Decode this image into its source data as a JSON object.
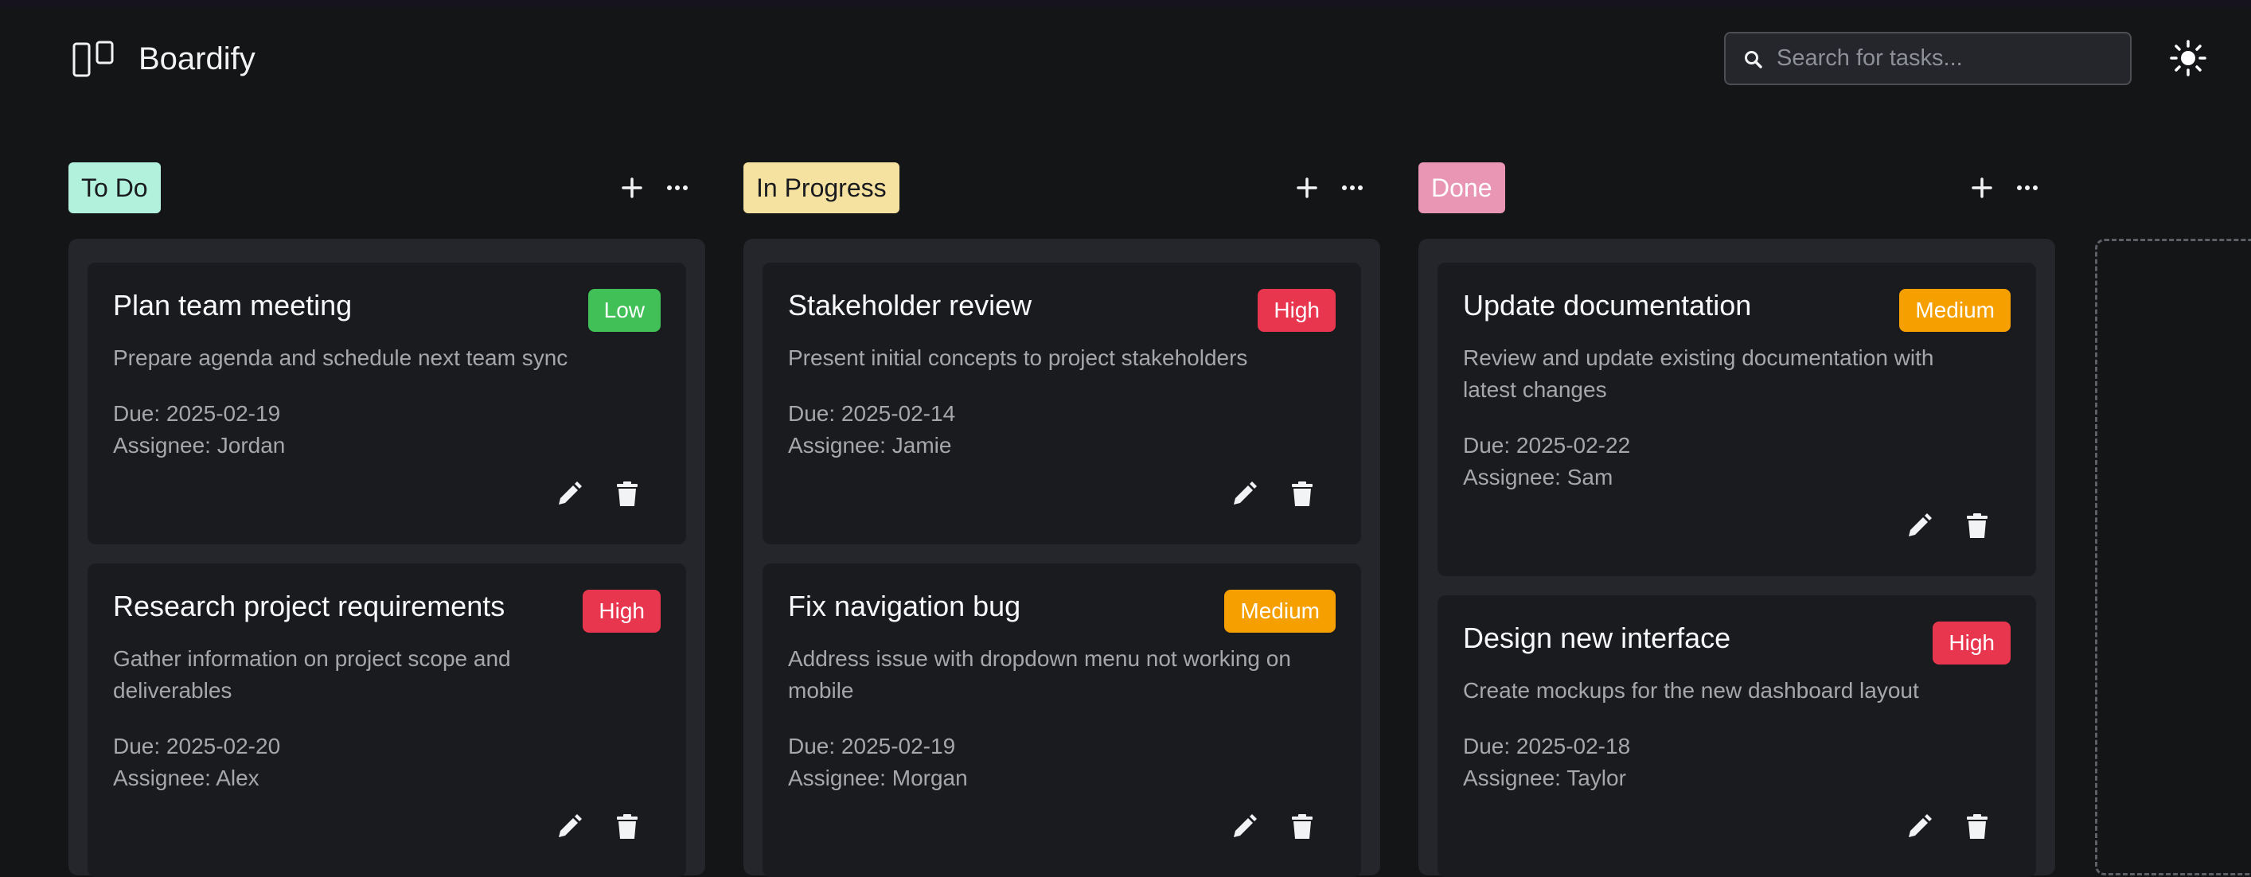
{
  "app": {
    "title": "Boardify"
  },
  "search": {
    "placeholder": "Search for tasks..."
  },
  "colors": {
    "todo": "#b2f2dc",
    "in_progress": "#f5e2a0",
    "done": "#e896b4",
    "priority_low": "#51cf66",
    "priority_medium": "#f59f00",
    "priority_high": "#e8364f"
  },
  "columns": [
    {
      "label": "To Do",
      "cards": [
        {
          "title": "Plan team meeting",
          "priority": "Low",
          "description": "Prepare agenda and schedule next team sync",
          "due": "Due: 2025-02-19",
          "assignee": "Assignee: Jordan"
        },
        {
          "title": "Research project requirements",
          "priority": "High",
          "description": "Gather information on project scope and deliverables",
          "due": "Due: 2025-02-20",
          "assignee": "Assignee: Alex"
        }
      ]
    },
    {
      "label": "In Progress",
      "cards": [
        {
          "title": "Stakeholder review",
          "priority": "High",
          "description": "Present initial concepts to project stakeholders",
          "due": "Due: 2025-02-14",
          "assignee": "Assignee: Jamie"
        },
        {
          "title": "Fix navigation bug",
          "priority": "Medium",
          "description": "Address issue with dropdown menu not working on mobile",
          "due": "Due: 2025-02-19",
          "assignee": "Assignee: Morgan"
        }
      ]
    },
    {
      "label": "Done",
      "cards": [
        {
          "title": "Update documentation",
          "priority": "Medium",
          "description": "Review and update existing documentation with latest changes",
          "due": "Due: 2025-02-22",
          "assignee": "Assignee: Sam"
        },
        {
          "title": "Design new interface",
          "priority": "High",
          "description": "Create mockups for the new dashboard layout",
          "due": "Due: 2025-02-18",
          "assignee": "Assignee: Taylor"
        }
      ]
    }
  ]
}
